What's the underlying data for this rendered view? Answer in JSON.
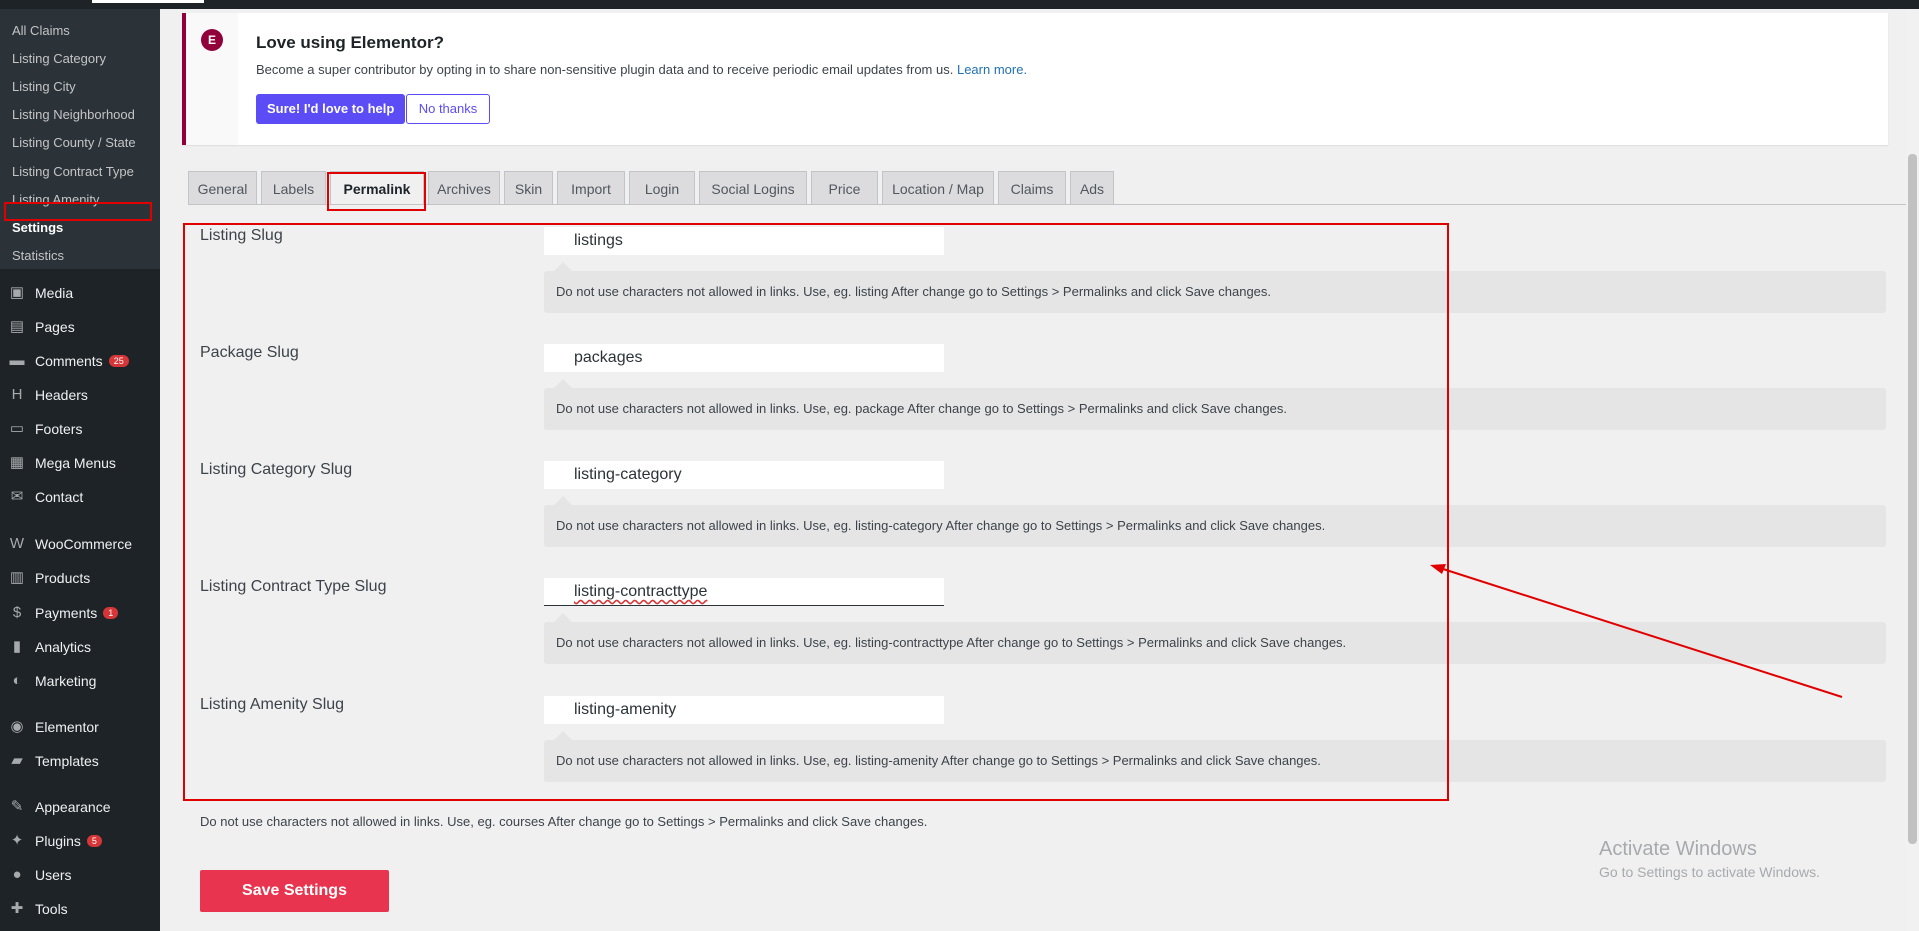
{
  "sidebar": {
    "submenu": [
      {
        "label": "All Claims"
      },
      {
        "label": "Listing Category"
      },
      {
        "label": "Listing City"
      },
      {
        "label": "Listing Neighborhood"
      },
      {
        "label": "Listing County / State"
      },
      {
        "label": "Listing Contract Type"
      },
      {
        "label": "Listing Amenity"
      },
      {
        "label": "Settings"
      },
      {
        "label": "Statistics"
      }
    ],
    "menu": [
      {
        "label": "Media",
        "icon": "media-icon",
        "glyph": "▣"
      },
      {
        "label": "Pages",
        "icon": "pages-icon",
        "glyph": "▤"
      },
      {
        "label": "Comments",
        "icon": "comments-icon",
        "glyph": "▬",
        "badge": "25"
      },
      {
        "label": "Headers",
        "icon": "headers-icon",
        "glyph": "H"
      },
      {
        "label": "Footers",
        "icon": "footers-icon",
        "glyph": "▭"
      },
      {
        "label": "Mega Menus",
        "icon": "mega-menus-icon",
        "glyph": "▦"
      },
      {
        "label": "Contact",
        "icon": "contact-icon",
        "glyph": "✉"
      },
      {
        "label": "WooCommerce",
        "icon": "woocommerce-icon",
        "glyph": "W"
      },
      {
        "label": "Products",
        "icon": "products-icon",
        "glyph": "▥"
      },
      {
        "label": "Payments",
        "icon": "payments-icon",
        "glyph": "$",
        "badge": "1"
      },
      {
        "label": "Analytics",
        "icon": "analytics-icon",
        "glyph": "▮"
      },
      {
        "label": "Marketing",
        "icon": "marketing-icon",
        "glyph": "◐"
      },
      {
        "label": "Elementor",
        "icon": "elementor-icon",
        "glyph": "◉"
      },
      {
        "label": "Templates",
        "icon": "templates-icon",
        "glyph": "▰"
      },
      {
        "label": "Appearance",
        "icon": "appearance-icon",
        "glyph": "✎"
      },
      {
        "label": "Plugins",
        "icon": "plugins-icon",
        "glyph": "✦",
        "badge": "5"
      },
      {
        "label": "Users",
        "icon": "users-icon",
        "glyph": "●"
      },
      {
        "label": "Tools",
        "icon": "tools-icon",
        "glyph": "✚"
      }
    ]
  },
  "notice": {
    "title": "Love using Elementor?",
    "description": "Become a super contributor by opting in to share non-sensitive plugin data and to receive periodic email updates from us.",
    "learn_more": "Learn more.",
    "accept_label": "Sure! I'd love to help",
    "decline_label": "No thanks",
    "logo_glyph": "E"
  },
  "tabs": [
    {
      "label": "General"
    },
    {
      "label": "Labels"
    },
    {
      "label": "Permalink"
    },
    {
      "label": "Archives"
    },
    {
      "label": "Skin"
    },
    {
      "label": "Import"
    },
    {
      "label": "Login"
    },
    {
      "label": "Social Logins"
    },
    {
      "label": "Price"
    },
    {
      "label": "Location / Map"
    },
    {
      "label": "Claims"
    },
    {
      "label": "Ads"
    }
  ],
  "active_tab": "Permalink",
  "fields": [
    {
      "label": "Listing Slug",
      "value": "listings",
      "help": "Do not use characters not allowed in links. Use, eg. listing After change go to Settings > Permalinks and click Save changes."
    },
    {
      "label": "Package Slug",
      "value": "packages",
      "help": "Do not use characters not allowed in links. Use, eg. package After change go to Settings > Permalinks and click Save changes."
    },
    {
      "label": "Listing Category Slug",
      "value": "listing-category",
      "help": "Do not use characters not allowed in links. Use, eg. listing-category After change go to Settings > Permalinks and click Save changes."
    },
    {
      "label": "Listing Contract Type Slug",
      "value": "listing-contracttype",
      "help": "Do not use characters not allowed in links. Use, eg. listing-contracttype After change go to Settings > Permalinks and click Save changes."
    },
    {
      "label": "Listing Amenity Slug",
      "value": "listing-amenity",
      "help": "Do not use characters not allowed in links. Use, eg. listing-amenity After change go to Settings > Permalinks and click Save changes."
    }
  ],
  "footer_note": "Do not use characters not allowed in links. Use, eg. courses After change go to Settings > Permalinks and click Save changes.",
  "save_label": "Save Settings",
  "watermark": {
    "title": "Activate Windows",
    "subtitle": "Go to Settings to activate Windows."
  },
  "colors": {
    "sidebar_bg": "#1d2327",
    "submenu_bg": "#2c3338",
    "highlight_red": "#e00000",
    "save_button": "#e8344e",
    "elementor_accent": "#92003b",
    "primary_button": "#5b4cf5",
    "link": "#2271b1"
  }
}
